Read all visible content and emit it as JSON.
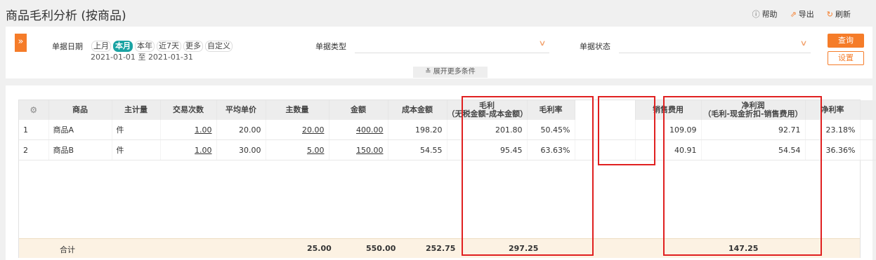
{
  "page": {
    "title": "商品毛利分析 (按商品)"
  },
  "toolbar": {
    "help": "帮助",
    "export": "导出",
    "refresh": "刷新"
  },
  "filter": {
    "toggle": "»",
    "date_label": "单据日期",
    "quick_ranges": [
      "上月",
      "本月",
      "本年",
      "近7天",
      "更多",
      "自定义"
    ],
    "date_start": "2021-01-01",
    "date_sep": "至",
    "date_end": "2021-01-31",
    "type_label": "单据类型",
    "type_value": "",
    "status_label": "单据状态",
    "status_value": "",
    "query_button": "查询",
    "settings_button": "设置",
    "more_conditions": "展开更多条件"
  },
  "table": {
    "headers": {
      "product": "商品",
      "unit": "主计量",
      "count": "交易次数",
      "avg_price": "平均单价",
      "qty": "主数量",
      "amount": "金额",
      "cost": "成本金额",
      "gross_profit": "毛利",
      "gross_profit_sub": "（无税金额-成本金额）",
      "gross_rate": "毛利率",
      "sales_fee": "销售费用",
      "net_profit": "净利润",
      "net_profit_sub": "（毛利-现金折扣-销售费用）",
      "net_rate": "净利率"
    },
    "rows": [
      {
        "no": "1",
        "product": "商品A",
        "unit": "件",
        "count": "1.00",
        "avg_price": "20.00",
        "qty": "20.00",
        "amount": "400.00",
        "cost": "198.20",
        "gross_profit": "201.80",
        "gross_rate": "50.45%",
        "sales_fee": "109.09",
        "net_profit": "92.71",
        "net_rate": "23.18%"
      },
      {
        "no": "2",
        "product": "商品B",
        "unit": "件",
        "count": "1.00",
        "avg_price": "30.00",
        "qty": "5.00",
        "amount": "150.00",
        "cost": "54.55",
        "gross_profit": "95.45",
        "gross_rate": "63.63%",
        "sales_fee": "40.91",
        "net_profit": "54.54",
        "net_rate": "36.36%"
      }
    ],
    "total": {
      "label": "合计",
      "qty": "25.00",
      "amount": "550.00",
      "cost": "252.75",
      "gross_profit": "297.25",
      "net_profit": "147.25"
    }
  },
  "colors": {
    "accent": "#f57c29",
    "active_chip": "#1aa3a3",
    "highlight_box": "#e02020",
    "total_bg": "#fcf2e3"
  }
}
